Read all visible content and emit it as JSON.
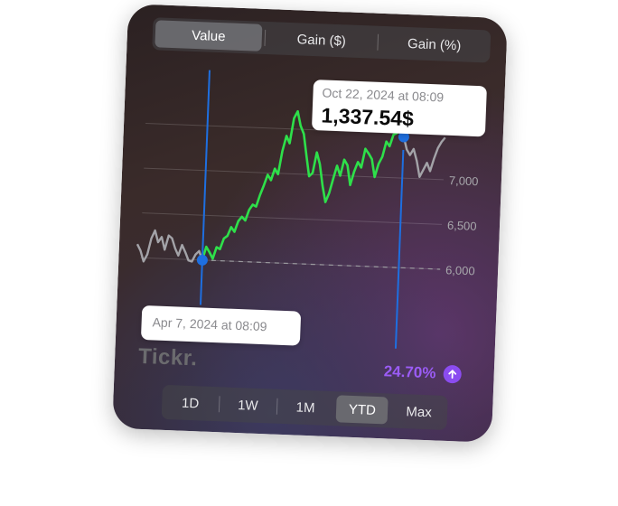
{
  "tabs": [
    {
      "label": "Value",
      "active": true
    },
    {
      "label": "Gain ($)",
      "active": false
    },
    {
      "label": "Gain (%)",
      "active": false
    }
  ],
  "tooltip_top": {
    "date": "Oct 22, 2024 at 08:09",
    "value": "1,337.54$"
  },
  "tooltip_bottom": {
    "date": "Apr 7, 2024 at 08:09"
  },
  "brand": "Tickr.",
  "gain": {
    "text": "24.70%",
    "icon": "arrow-up-icon",
    "color": "#9b5cf6"
  },
  "ranges": [
    {
      "label": "1D",
      "active": false
    },
    {
      "label": "1W",
      "active": false
    },
    {
      "label": "1M",
      "active": false
    },
    {
      "label": "YTD",
      "active": true
    },
    {
      "label": "Max",
      "active": false
    }
  ],
  "chart_data": {
    "type": "line",
    "y_ticks": [
      "6,000",
      "6,500",
      "7,000"
    ],
    "colors": {
      "selected": "#2ee04a",
      "outside": "#a3a3a8",
      "marker": "#1e6fe0",
      "baseline": "#9a9a9e"
    },
    "series": [
      {
        "values": [
          6150,
          6080,
          5960,
          6040,
          6220,
          6310,
          6180,
          6240,
          6100,
          6260,
          6230,
          6120,
          6040,
          6160,
          6080,
          5990,
          5980,
          6060,
          6100,
          6000,
          6150,
          6090,
          6020,
          6150,
          6130,
          6250,
          6280,
          6380,
          6330,
          6450,
          6500,
          6460,
          6580,
          6640,
          6620,
          6750,
          6860,
          6980,
          6920,
          7050,
          6990,
          7250,
          7420,
          7340,
          7620,
          7700,
          7540,
          7450,
          7210,
          6980,
          7020,
          7250,
          7120,
          6880,
          6700,
          6800,
          6960,
          7110,
          7000,
          7180,
          7120,
          6900,
          7050,
          7160,
          7100,
          7310,
          7260,
          7200,
          7000,
          7150,
          7230,
          7400,
          7350,
          7480,
          7500,
          7560,
          7460,
          7320,
          7260,
          7330,
          7200,
          7020,
          7100,
          7180,
          7090,
          7230,
          7350,
          7420,
          7470
        ]
      }
    ],
    "selected_range": {
      "start_index": 19,
      "end_index": 76
    }
  }
}
